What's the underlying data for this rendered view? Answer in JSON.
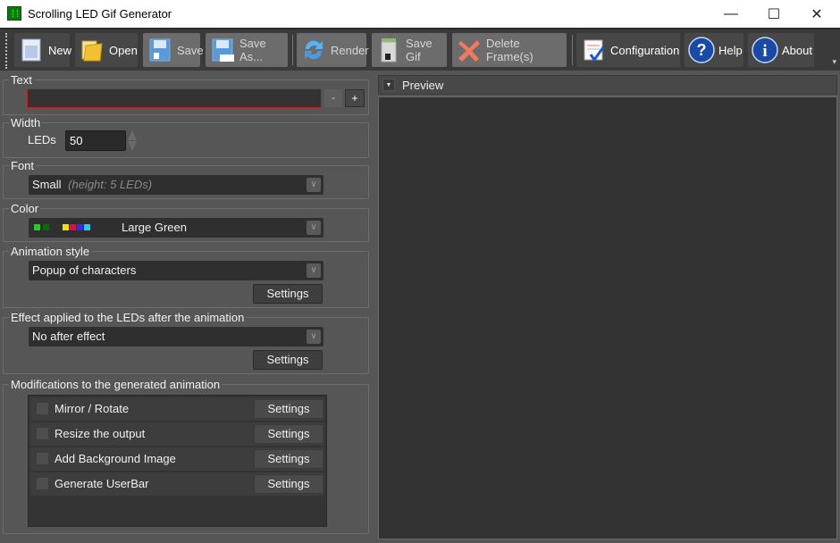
{
  "window": {
    "title": "Scrolling LED Gif Generator",
    "minimize": "—",
    "maximize": "☐",
    "close": "✕"
  },
  "toolbar": {
    "new_label": "New",
    "open_label": "Open",
    "save_label": "Save",
    "save_as_label": "Save As...",
    "render_label": "Render",
    "save_gif_label": "Save Gif",
    "delete_frames_label": "Delete Frame(s)",
    "configuration_label": "Configuration",
    "help_label": "Help",
    "about_label": "About",
    "overflow": "▾"
  },
  "text_group": {
    "label": "Text",
    "value": "",
    "minus": "-",
    "plus": "+"
  },
  "width_group": {
    "label": "Width",
    "leds_label": "LEDs",
    "leds_value": "50"
  },
  "font_group": {
    "label": "Font",
    "selected_name": "Small",
    "selected_hint": "(height:  5  LEDs)"
  },
  "color_group": {
    "label": "Color",
    "selected": "Large Green",
    "swatches": [
      "#22cc22",
      "#0c6a0c",
      "#e8e020",
      "#e0103a",
      "#3a2ae0",
      "#30c8e8"
    ]
  },
  "animation_group": {
    "label": "Animation style",
    "selected": "Popup of characters",
    "settings": "Settings"
  },
  "effect_group": {
    "label": "Effect applied to the LEDs after the animation",
    "selected": "No after effect",
    "settings": "Settings"
  },
  "modifications_group": {
    "label": "Modifications to the generated animation",
    "items": [
      {
        "label": "Mirror / Rotate",
        "checked": false,
        "settings": "Settings"
      },
      {
        "label": "Resize the output",
        "checked": false,
        "settings": "Settings"
      },
      {
        "label": "Add Background Image",
        "checked": false,
        "settings": "Settings"
      },
      {
        "label": "Generate UserBar",
        "checked": false,
        "settings": "Settings"
      }
    ]
  },
  "preview": {
    "title": "Preview",
    "collapse_icon": "▼"
  }
}
